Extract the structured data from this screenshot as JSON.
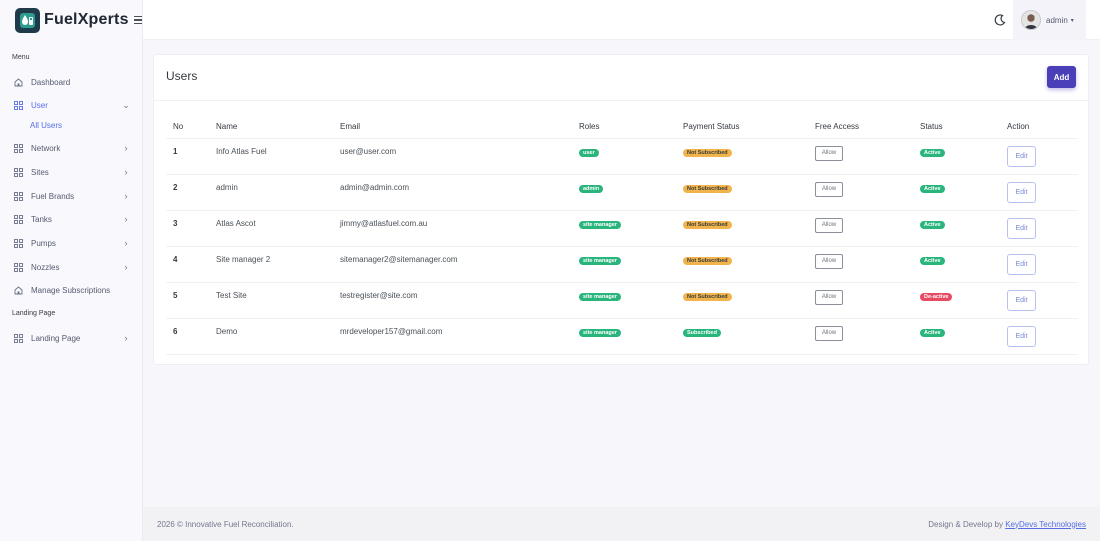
{
  "brand": {
    "name": "FuelXperts"
  },
  "sidebar": {
    "menu_title": "Menu",
    "landing_title": "Landing Page",
    "items": [
      {
        "label": "Dashboard",
        "icon": "home-icon",
        "chevron": ""
      },
      {
        "label": "User",
        "icon": "grid-icon",
        "chevron": "down"
      },
      {
        "label": "Network",
        "icon": "grid-icon",
        "chevron": "right"
      },
      {
        "label": "Sites",
        "icon": "grid-icon",
        "chevron": "right"
      },
      {
        "label": "Fuel Brands",
        "icon": "grid-icon",
        "chevron": "right"
      },
      {
        "label": "Tanks",
        "icon": "grid-icon",
        "chevron": "right"
      },
      {
        "label": "Pumps",
        "icon": "grid-icon",
        "chevron": "right"
      },
      {
        "label": "Nozzles",
        "icon": "grid-icon",
        "chevron": "right"
      },
      {
        "label": "Manage Subscriptions",
        "icon": "home-icon",
        "chevron": ""
      },
      {
        "label": "Landing Page",
        "icon": "grid-icon",
        "chevron": "right"
      }
    ],
    "user_sub": "All Users"
  },
  "topbar": {
    "user_name": "admin"
  },
  "page": {
    "title": "Users",
    "add_label": "Add"
  },
  "table": {
    "headers": [
      "No",
      "Name",
      "Email",
      "Roles",
      "Payment Status",
      "Free Access",
      "Status",
      "Action"
    ],
    "rows": [
      {
        "no": "1",
        "name": "Info Atlas Fuel",
        "email": "user@user.com",
        "role": "user",
        "payment": "Not Subscribed",
        "free": "Allow",
        "status": "Active",
        "action": "Edit"
      },
      {
        "no": "2",
        "name": "admin",
        "email": "admin@admin.com",
        "role": "admin",
        "payment": "Not Subscribed",
        "free": "Allow",
        "status": "Active",
        "action": "Edit"
      },
      {
        "no": "3",
        "name": "Atlas Ascot",
        "email": "jimmy@atlasfuel.com.au",
        "role": "site manager",
        "payment": "Not Subscribed",
        "free": "Allow",
        "status": "Active",
        "action": "Edit"
      },
      {
        "no": "4",
        "name": "Site manager 2",
        "email": "sitemanager2@sitemanager.com",
        "role": "site manager",
        "payment": "Not Subscribed",
        "free": "Allow",
        "status": "Active",
        "action": "Edit"
      },
      {
        "no": "5",
        "name": "Test Site",
        "email": "testregister@site.com",
        "role": "site manager",
        "payment": "Not Subscribed",
        "free": "Allow",
        "status": "De-active",
        "action": "Edit"
      },
      {
        "no": "6",
        "name": "Demo",
        "email": "mrdeveloper157@gmail.com",
        "role": "site manager",
        "payment": "Subscribed",
        "free": "Allow",
        "status": "Active",
        "action": "Edit"
      }
    ]
  },
  "footer": {
    "copyright": "2026 © Innovative Fuel Reconciliation.",
    "credit_prefix": "Design & Develop by ",
    "credit_link": "KeyDevs Technologies"
  },
  "colors": {
    "primary": "#4b3fb8",
    "accent": "#556ee6",
    "success": "#2ab57d",
    "warning": "#f1b44c",
    "danger": "#e84a62"
  }
}
